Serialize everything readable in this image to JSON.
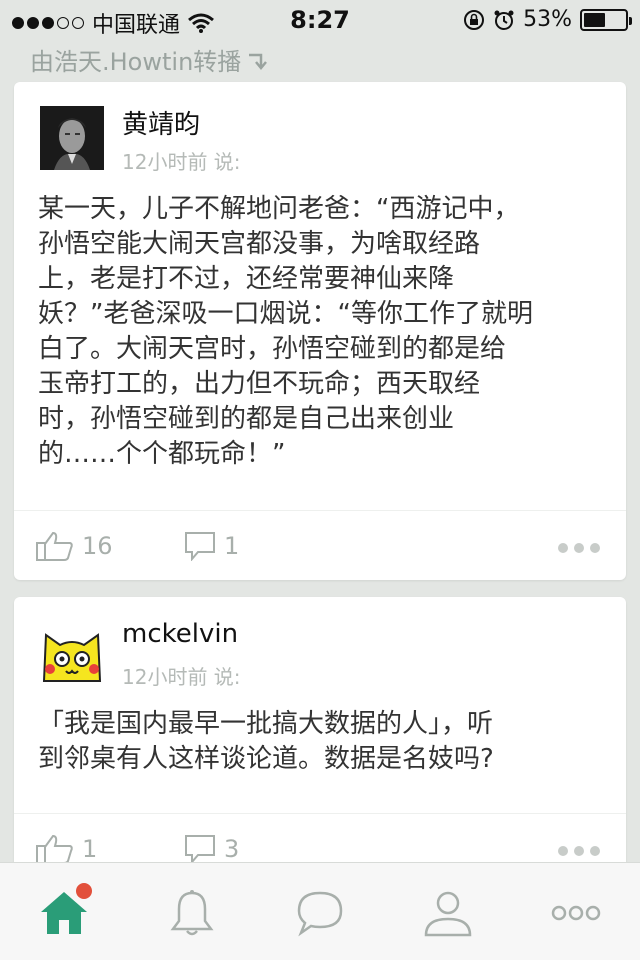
{
  "status_bar": {
    "carrier": "中国联通",
    "time": "8:27",
    "battery": "53%",
    "battery_level": 0.53,
    "signal_bars": 3
  },
  "repost_label": "由浩天.Howtin转播",
  "posts": [
    {
      "author": "黄靖昀",
      "meta": "12小时前 说:",
      "content_lines": [
        "某一天，儿子不解地问老爸：“西游记中，",
        "孙悟空能大闹天宫都没事，为啥取经路",
        "上，老是打不过，还经常要神仙来降",
        "妖？”老爸深吸一口烟说：“等你工作了就明",
        "白了。大闹天宫时，孙悟空碰到的都是给",
        "玉帝打工的，出力但不玩命；西天取经",
        "时，孙悟空碰到的都是自己出来创业",
        "的……个个都玩命！”"
      ],
      "likes": "16",
      "comments": "1"
    },
    {
      "author": "mckelvin",
      "meta": "12小时前 说:",
      "content_lines": [
        "「我是国内最早一批搞大数据的人」，听",
        "到邻桌有人这样谈论道。数据是名妓吗?"
      ],
      "likes": "1",
      "comments": "3"
    }
  ],
  "tabs": [
    "home-icon",
    "bell-icon",
    "chat-icon",
    "profile-icon",
    "more-icon"
  ],
  "colors": {
    "accent": "#2a9d78",
    "badge": "#e2503b",
    "background": "#e3e6e3"
  }
}
